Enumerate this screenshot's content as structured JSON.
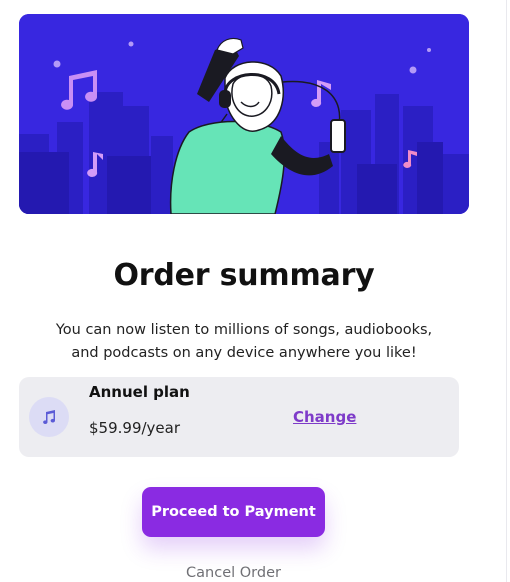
{
  "hero": {
    "illustration": "person-dancing-with-headphones-and-phone-music-notes-city"
  },
  "summary": {
    "title": "Order summary",
    "description": "You can now listen to millions of songs, audiobooks, and podcasts on any device anywhere you like!"
  },
  "plan": {
    "icon": "music-note-icon",
    "name": "Annuel plan",
    "price": "$59.99/year",
    "change_label": "Change"
  },
  "actions": {
    "proceed_label": "Proceed to Payment",
    "cancel_label": "Cancel Order"
  },
  "colors": {
    "hero_background": "#3827e0",
    "accent": "#8a2be2",
    "link": "#7e3bc9",
    "card_background": "#ededf1"
  }
}
